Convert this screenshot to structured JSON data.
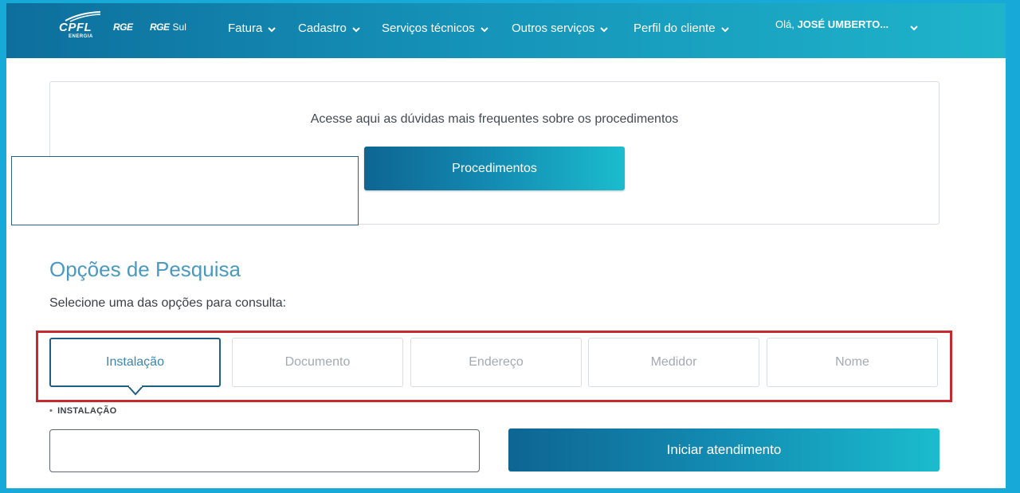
{
  "header": {
    "logo_text": "CPFL",
    "logo_sub": "ENERGIA",
    "brand_1": "RGE",
    "brand_2": "RGE",
    "brand_2_suffix": "Sul",
    "nav": [
      {
        "label": "Fatura",
        "icon": "chevron-down-icon"
      },
      {
        "label": "Cadastro",
        "icon": "chevron-down-icon"
      },
      {
        "label": "Serviços técnicos",
        "icon": "chevron-down-icon"
      },
      {
        "label": "Outros serviços",
        "icon": "chevron-down-icon"
      },
      {
        "label": "Perfil do cliente",
        "icon": "chevron-down-icon"
      }
    ],
    "greeting": "Olá,",
    "user_name": "JOSÉ UMBERTO..."
  },
  "procedures": {
    "text": "Acesse aqui as dúvidas mais frequentes sobre os procedimentos",
    "button": "Procedimentos"
  },
  "search": {
    "title": "Opções de Pesquisa",
    "subtitle": "Selecione uma das opções para consulta:",
    "options": [
      "Instalação",
      "Documento",
      "Endereço",
      "Medidor",
      "Nome"
    ],
    "selected": "Instalação",
    "field_label": "INSTALAÇÃO",
    "field_value": "",
    "start_button": "Iniciar atendimento"
  },
  "colors": {
    "header_start": "#0d6e9c",
    "header_end": "#1fb5cb",
    "accent": "#1d5f86",
    "title": "#4a9ac0",
    "highlight": "#c8282f",
    "frame": "#17a9d8"
  }
}
